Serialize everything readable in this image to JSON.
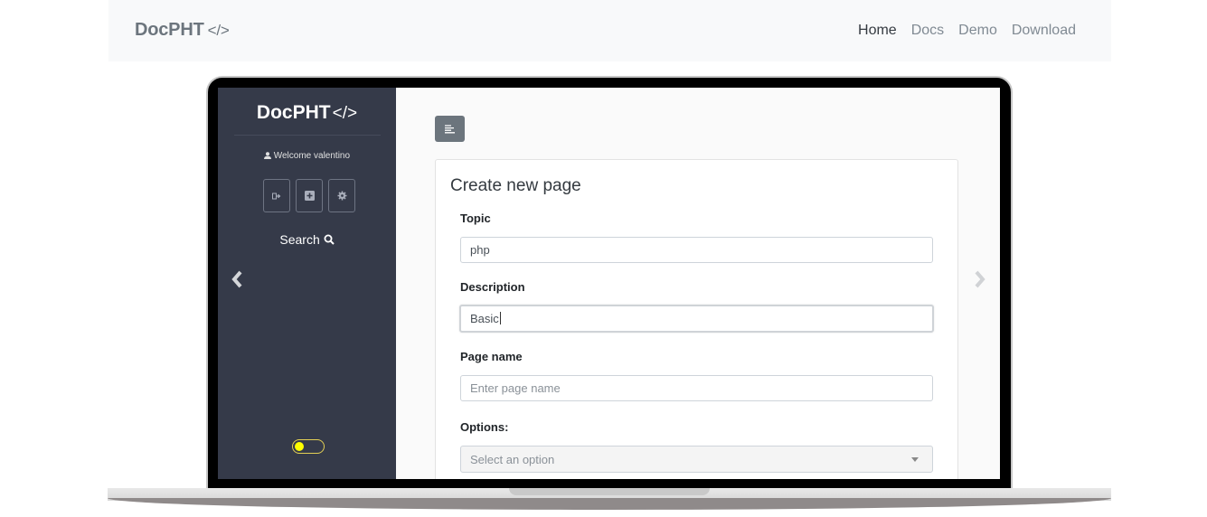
{
  "navbar": {
    "brand": "DocPHT",
    "brand_code": "</>",
    "links": [
      {
        "label": "Home",
        "active": true
      },
      {
        "label": "Docs",
        "active": false
      },
      {
        "label": "Demo",
        "active": false
      },
      {
        "label": "Download",
        "active": false
      }
    ]
  },
  "sidebar": {
    "brand": "DocPHT",
    "brand_code": "</>",
    "welcome": "Welcome valentino",
    "buttons": [
      {
        "icon": "logout-icon"
      },
      {
        "icon": "add-page-icon"
      },
      {
        "icon": "settings-gear-icon"
      }
    ],
    "search_label": "Search",
    "theme_toggle_color": "#ffff00"
  },
  "main": {
    "card_title": "Create new page",
    "topic": {
      "label": "Topic",
      "value": "php"
    },
    "description": {
      "label": "Description",
      "value": "Basic"
    },
    "page_name": {
      "label": "Page name",
      "placeholder": "Enter page name"
    },
    "options": {
      "label": "Options:",
      "selected": "Select an option"
    }
  },
  "colors": {
    "sidebar_bg": "#353a49",
    "toggle_button_bg": "#6c757d",
    "navbar_bg": "#f8f9fa"
  }
}
